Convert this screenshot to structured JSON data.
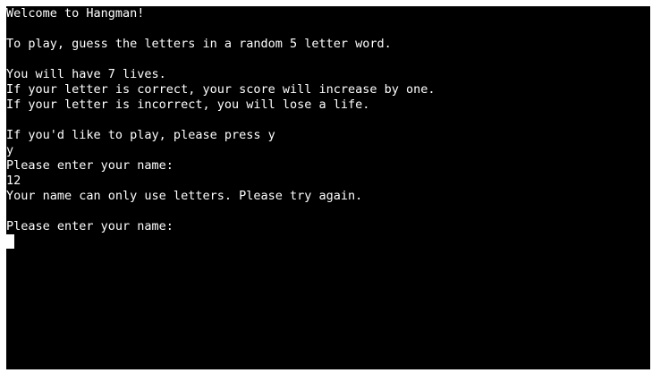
{
  "terminal": {
    "lines": [
      "Welcome to Hangman!",
      "",
      "To play, guess the letters in a random 5 letter word.",
      "",
      "You will have 7 lives.",
      "If your letter is correct, your score will increase by one.",
      "If your letter is incorrect, you will lose a life.",
      "",
      "If you'd like to play, please press y",
      "y",
      "Please enter your name:",
      "12",
      "Your name can only use letters. Please try again.",
      "",
      "Please enter your name:"
    ],
    "colors": {
      "background": "#000000",
      "text": "#ffffff",
      "cursor": "#ffffff"
    }
  }
}
